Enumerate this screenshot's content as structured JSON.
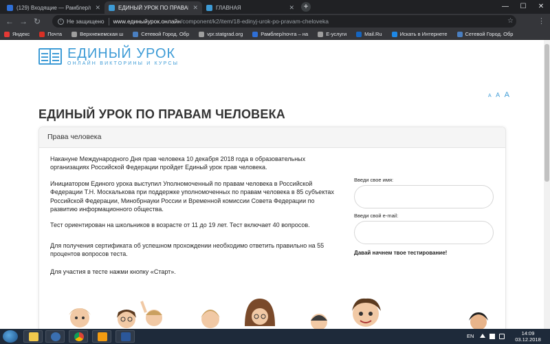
{
  "browser": {
    "tabs": [
      {
        "title": "(129) Входящие — Рамблер/почта",
        "favicon_color": "#2f6fd6",
        "active": false
      },
      {
        "title": "ЕДИНЫЙ УРОК ПО ПРАВАМ ЧЕЛОВЕКА",
        "favicon_color": "#3d9bd6",
        "active": true
      },
      {
        "title": "ГЛАВНАЯ",
        "favicon_color": "#3d9bd6",
        "active": false
      }
    ],
    "new_tab": "+",
    "window_controls": {
      "minimize": "—",
      "maximize": "☐",
      "close": "✕"
    },
    "address": {
      "security_label": "Не защищено",
      "host": "www.единыйурок.онлайн",
      "path": "/component/k2/item/18-edinyj-urok-po-pravam-cheloveka"
    },
    "bookmarks": [
      {
        "label": "Яндекс",
        "color": "#e53935"
      },
      {
        "label": "Почта",
        "color": "#d93025"
      },
      {
        "label": "Верхнежемская ш",
        "color": "#9e9e9e"
      },
      {
        "label": "Сетевой Город. Обр",
        "color": "#4a7fc1"
      },
      {
        "label": "vpr.statgrad.org",
        "color": "#9e9e9e"
      },
      {
        "label": "Рамблер/почта – на",
        "color": "#2f6fd6"
      },
      {
        "label": "Е-услуги",
        "color": "#9e9e9e"
      },
      {
        "label": "Mail.Ru",
        "color": "#1565c0"
      },
      {
        "label": "Искать в Интернете",
        "color": "#1e88e5"
      },
      {
        "label": "Сетевой Город. Обр",
        "color": "#4a7fc1"
      }
    ]
  },
  "site": {
    "logo_title": "ЕДИНЫЙ УРОК",
    "logo_subtitle": "ОНЛАЙН ВИКТОРИНЫ И КУРСЫ",
    "accent_color": "#3d9bd6",
    "font_size_controls": [
      "A",
      "A",
      "A"
    ],
    "page_title": "ЕДИНЫЙ УРОК ПО ПРАВАМ ЧЕЛОВЕКА",
    "card_title": "Права человека",
    "paragraphs": [
      [
        "Накануне Международного Дня прав человека 10 декабря 2018 года в образовательных",
        "организациях Российской Федерации пройдет Единый урок прав человека."
      ],
      [
        "Инициатором Единого урока выступил Уполномоченный по правам человека в Российской",
        "Федерации  Т.Н. Москалькова при поддержке уполномоченных по правам человека в 85 субъектах",
        "Российской Федерации, Минобрнауки России и Временной комиссии Совета Федерации по",
        "развитию информационного общества."
      ],
      [
        "Тест ориентирован на школьников в возрасте от 11 до 19 лет. Тест включает 40 вопросов."
      ],
      [
        "Для получения сертификата об успешном прохождении необходимо ответить правильно на 55",
        "процентов вопросов теста."
      ],
      [
        "Для участия в тесте нажми кнопку «Старт»."
      ]
    ],
    "form": {
      "name_label": "Введи свое имя:",
      "name_value": "",
      "email_label": "Введи свой e-mail:",
      "email_value": "",
      "cta": "Давай начнем твое тестирование!"
    }
  },
  "taskbar": {
    "lang": "EN",
    "time": "14:09",
    "date": "03.12.2018"
  }
}
